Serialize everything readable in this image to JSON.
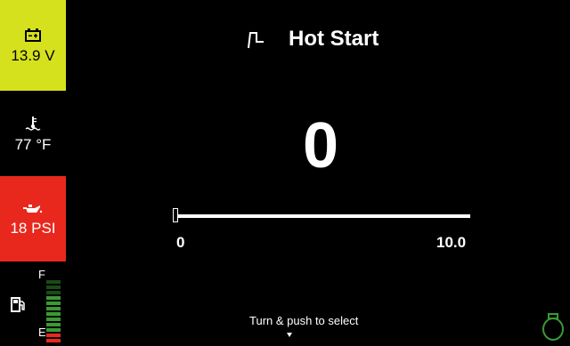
{
  "sidebar": {
    "battery": {
      "value": "13.9 V",
      "icon": "battery-icon",
      "color": "#d6e11e"
    },
    "temperature": {
      "value": "77 °F",
      "icon": "coolant-temperature-icon"
    },
    "oil_pressure": {
      "value": "18 PSI",
      "icon": "oil-can-icon",
      "color": "#e8281d"
    },
    "fuel": {
      "icon": "fuel-pump-icon",
      "full_label": "F",
      "empty_label": "E",
      "level": 0.75,
      "segment_count": 12
    }
  },
  "header": {
    "title": "Hot Start",
    "icon": "hot-start-icon"
  },
  "main": {
    "value": "0"
  },
  "slider": {
    "min_label": "0",
    "max_label": "10.0",
    "level": 0.0
  },
  "footer": {
    "hint": "Turn & push to select",
    "status_icon": "engine-status-icon"
  },
  "colors": {
    "green": "#3a9a33",
    "red": "#e8281d",
    "accent": "#d6e11e"
  }
}
